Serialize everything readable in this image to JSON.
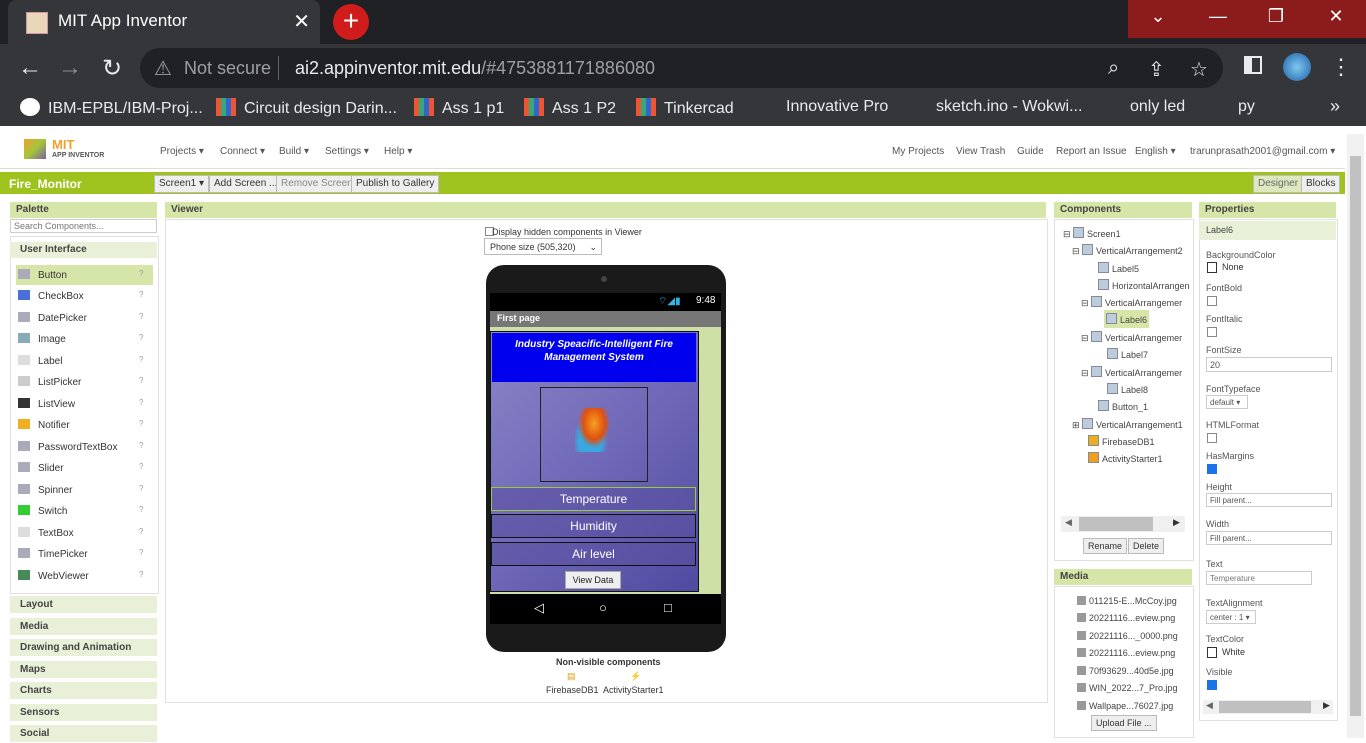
{
  "browser": {
    "tab_title": "MIT App Inventor",
    "tab_close": "✕",
    "new_tab": "+",
    "not_secure": "Not secure",
    "url_domain": "ai2.appinventor.mit.edu",
    "url_rest": "/#4753881171886080",
    "bookmarks": [
      "IBM-EPBL/IBM-Proj...",
      "Circuit design Darin...",
      "Ass 1 p1",
      "Ass 1 P2",
      "Tinkercad",
      "Innovative Pro",
      "sketch.ino - Wokwi...",
      "only led",
      "py"
    ],
    "more": "»"
  },
  "ai": {
    "logo_text": "MIT",
    "logo_sub": "APP INVENTOR",
    "menus": [
      "Projects ▾",
      "Connect ▾",
      "Build ▾",
      "Settings ▾",
      "Help ▾"
    ],
    "right_links": [
      "My Projects",
      "View Trash",
      "Guide",
      "Report an Issue",
      "English ▾",
      "trarunprasath2001@gmail.com ▾"
    ],
    "project_name": "Fire_Monitor",
    "screen_select": "Screen1 ▾",
    "add_screen": "Add Screen ...",
    "remove_screen": "Remove Screen",
    "publish": "Publish to Gallery",
    "designer": "Designer",
    "blocks": "Blocks"
  },
  "palette": {
    "title": "Palette",
    "search_placeholder": "Search Components...",
    "category": "User Interface",
    "items": [
      "Button",
      "CheckBox",
      "DatePicker",
      "Image",
      "Label",
      "ListPicker",
      "ListView",
      "Notifier",
      "PasswordTextBox",
      "Slider",
      "Spinner",
      "Switch",
      "TextBox",
      "TimePicker",
      "WebViewer"
    ],
    "help": "?",
    "categories": [
      "Layout",
      "Media",
      "Drawing and Animation",
      "Maps",
      "Charts",
      "Sensors",
      "Social"
    ]
  },
  "viewer": {
    "title": "Viewer",
    "hidden_label": "Display hidden components in Viewer",
    "size_select": "Phone size (505,320)",
    "time": "9:48",
    "app_title": "First page",
    "heading": "Industry Speacific-Intelligent Fire Management System",
    "buttons": [
      "Temperature",
      "Humidity",
      "Air level"
    ],
    "view_data": "View Data",
    "nonvisible_title": "Non-visible components",
    "nonvisible": [
      "FirebaseDB1",
      "ActivityStarter1"
    ]
  },
  "components": {
    "title": "Components",
    "tree": [
      "Screen1",
      "VerticalArrangement2",
      "Label5",
      "HorizontalArrangen",
      "VerticalArrangemer",
      "Label6",
      "VerticalArrangemer",
      "Label7",
      "VerticalArrangemer",
      "Label8",
      "Button_1",
      "VerticalArrangement1",
      "FirebaseDB1",
      "ActivityStarter1"
    ],
    "rename": "Rename",
    "delete": "Delete"
  },
  "media": {
    "title": "Media",
    "files": [
      "011215-E...McCoy.jpg",
      "20221116...eview.png",
      "20221116..._0000.png",
      "20221116...eview.png",
      "70f93629...40d5e.jpg",
      "WIN_2022...7_Pro.jpg",
      "Wallpape...76027.jpg"
    ],
    "upload": "Upload File ..."
  },
  "properties": {
    "title": "Properties",
    "component": "Label6",
    "background_color_label": "BackgroundColor",
    "background_color": "None",
    "font_bold_label": "FontBold",
    "font_italic_label": "FontItalic",
    "font_size_label": "FontSize",
    "font_size": "20",
    "font_typeface_label": "FontTypeface",
    "font_typeface": "default ▾",
    "html_format_label": "HTMLFormat",
    "has_margins_label": "HasMargins",
    "height_label": "Height",
    "height": "Fill parent...",
    "width_label": "Width",
    "width": "Fill parent...",
    "text_label": "Text",
    "text": "Temperature",
    "text_alignment_label": "TextAlignment",
    "text_alignment": "center : 1 ▾",
    "text_color_label": "TextColor",
    "text_color": "White",
    "visible_label": "Visible",
    "font_bold_checked": false,
    "font_italic_checked": false,
    "html_format_checked": false,
    "has_margins_checked": true,
    "visible_checked": true
  },
  "colors": {
    "green_bar": "#9fc31e",
    "panel_head": "#d6e6a8",
    "heading_blue": "#0000ee"
  }
}
